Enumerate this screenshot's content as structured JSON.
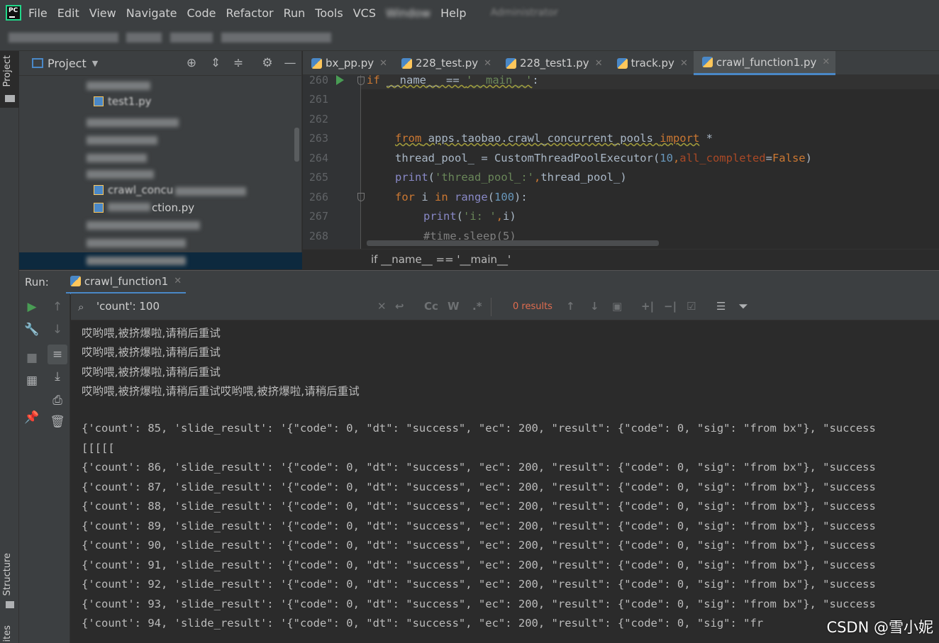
{
  "menu": {
    "items": [
      "File",
      "Edit",
      "View",
      "Navigate",
      "Code",
      "Refactor",
      "Run",
      "Tools",
      "VCS",
      "Window",
      "Help"
    ],
    "window_title_partial": "Administrator"
  },
  "stripe": {
    "project_tab": "Project",
    "structure_tab": "Structure",
    "favorites_tab": "ites"
  },
  "project_panel": {
    "title": "Project",
    "tree_items": [
      "test1.py",
      "crawl_concu",
      "ction.py"
    ]
  },
  "editor": {
    "tabs": [
      {
        "label": "bx_pp.py",
        "active": false
      },
      {
        "label": "228_test.py",
        "active": false
      },
      {
        "label": "228_test1.py",
        "active": false
      },
      {
        "label": "track.py",
        "active": false
      },
      {
        "label": "crawl_function1.py",
        "active": true
      }
    ],
    "line_numbers": [
      "260",
      "261",
      "262",
      "263",
      "264",
      "265",
      "266",
      "267",
      "268"
    ],
    "breadcrumb": "if __name__ == '__main__'"
  },
  "run": {
    "label": "Run:",
    "tab_label": "crawl_function1",
    "search_value": "'count': 100",
    "results_label": "0 results",
    "output_lines": [
      "哎哟喂,被挤爆啦,请稍后重试",
      "哎哟喂,被挤爆啦,请稍后重试",
      "哎哟喂,被挤爆啦,请稍后重试",
      "哎哟喂,被挤爆啦,请稍后重试哎哟喂,被挤爆啦,请稍后重试",
      "",
      "{'count': 85, 'slide_result': '{\"code\": 0, \"dt\": \"success\", \"ec\": 200, \"result\": {\"code\": 0, \"sig\": \"from bx\"}, \"success",
      "[[[[[",
      "{'count': 86, 'slide_result': '{\"code\": 0, \"dt\": \"success\", \"ec\": 200, \"result\": {\"code\": 0, \"sig\": \"from bx\"}, \"success",
      "{'count': 87, 'slide_result': '{\"code\": 0, \"dt\": \"success\", \"ec\": 200, \"result\": {\"code\": 0, \"sig\": \"from bx\"}, \"success",
      "{'count': 88, 'slide_result': '{\"code\": 0, \"dt\": \"success\", \"ec\": 200, \"result\": {\"code\": 0, \"sig\": \"from bx\"}, \"success",
      "{'count': 89, 'slide_result': '{\"code\": 0, \"dt\": \"success\", \"ec\": 200, \"result\": {\"code\": 0, \"sig\": \"from bx\"}, \"success",
      "{'count': 90, 'slide_result': '{\"code\": 0, \"dt\": \"success\", \"ec\": 200, \"result\": {\"code\": 0, \"sig\": \"from bx\"}, \"success",
      "{'count': 91, 'slide_result': '{\"code\": 0, \"dt\": \"success\", \"ec\": 200, \"result\": {\"code\": 0, \"sig\": \"from bx\"}, \"success",
      "{'count': 92, 'slide_result': '{\"code\": 0, \"dt\": \"success\", \"ec\": 200, \"result\": {\"code\": 0, \"sig\": \"from bx\"}, \"success",
      "{'count': 93, 'slide_result': '{\"code\": 0, \"dt\": \"success\", \"ec\": 200, \"result\": {\"code\": 0, \"sig\": \"from bx\"}, \"success",
      "{'count': 94, 'slide_result': '{\"code\": 0, \"dt\": \"success\", \"ec\": 200, \"result\": {\"code\": 0, \"sig\": \"fr"
    ]
  },
  "watermark": "CSDN @雪小妮",
  "colors": {
    "accent": "#4a88c7",
    "keyword": "#cc7832",
    "string": "#6a8759",
    "number": "#6897bb",
    "results_text": "#e06c4f"
  }
}
